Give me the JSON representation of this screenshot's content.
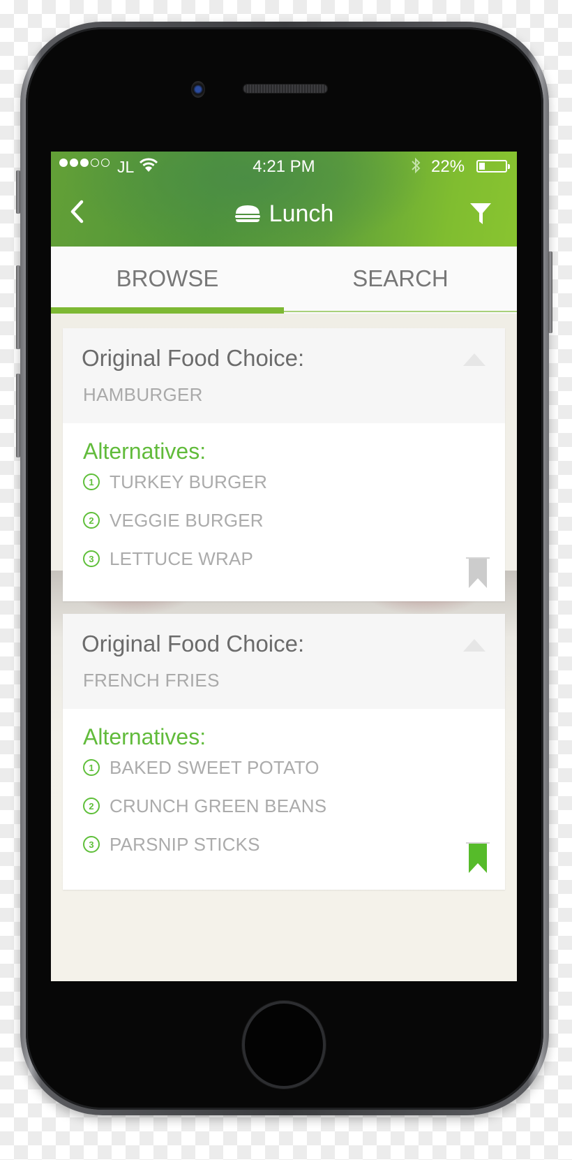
{
  "status_bar": {
    "signal_full": 3,
    "signal_total": 5,
    "carrier": "JL",
    "time": "4:21 PM",
    "bluetooth_icon": "bluetooth-icon",
    "battery_percent": "22%",
    "battery_level": 0.22
  },
  "nav": {
    "back_icon": "chevron-left-icon",
    "title_icon": "hamburger-icon",
    "title": "Lunch",
    "filter_icon": "filter-icon"
  },
  "tabs": [
    {
      "label": "BROWSE",
      "active": true
    },
    {
      "label": "SEARCH",
      "active": false
    }
  ],
  "colors": {
    "accent_green": "#61bb3b",
    "tab_indicator": "#7db833",
    "bookmark_active": "#56bb2a",
    "bookmark_inactive": "#cccccc"
  },
  "cards": [
    {
      "label": "Original Food Choice:",
      "value": "HAMBURGER",
      "alternatives_title": "Alternatives:",
      "alternatives": [
        {
          "num": "1",
          "text": "TURKEY BURGER"
        },
        {
          "num": "2",
          "text": "VEGGIE BURGER"
        },
        {
          "num": "3",
          "text": "LETTUCE WRAP"
        }
      ],
      "bookmarked": false
    },
    {
      "label": "Original Food Choice:",
      "value": "FRENCH FRIES",
      "alternatives_title": "Alternatives:",
      "alternatives": [
        {
          "num": "1",
          "text": "BAKED SWEET POTATO"
        },
        {
          "num": "2",
          "text": "CRUNCH GREEN BEANS"
        },
        {
          "num": "3",
          "text": "PARSNIP STICKS"
        }
      ],
      "bookmarked": true
    }
  ]
}
